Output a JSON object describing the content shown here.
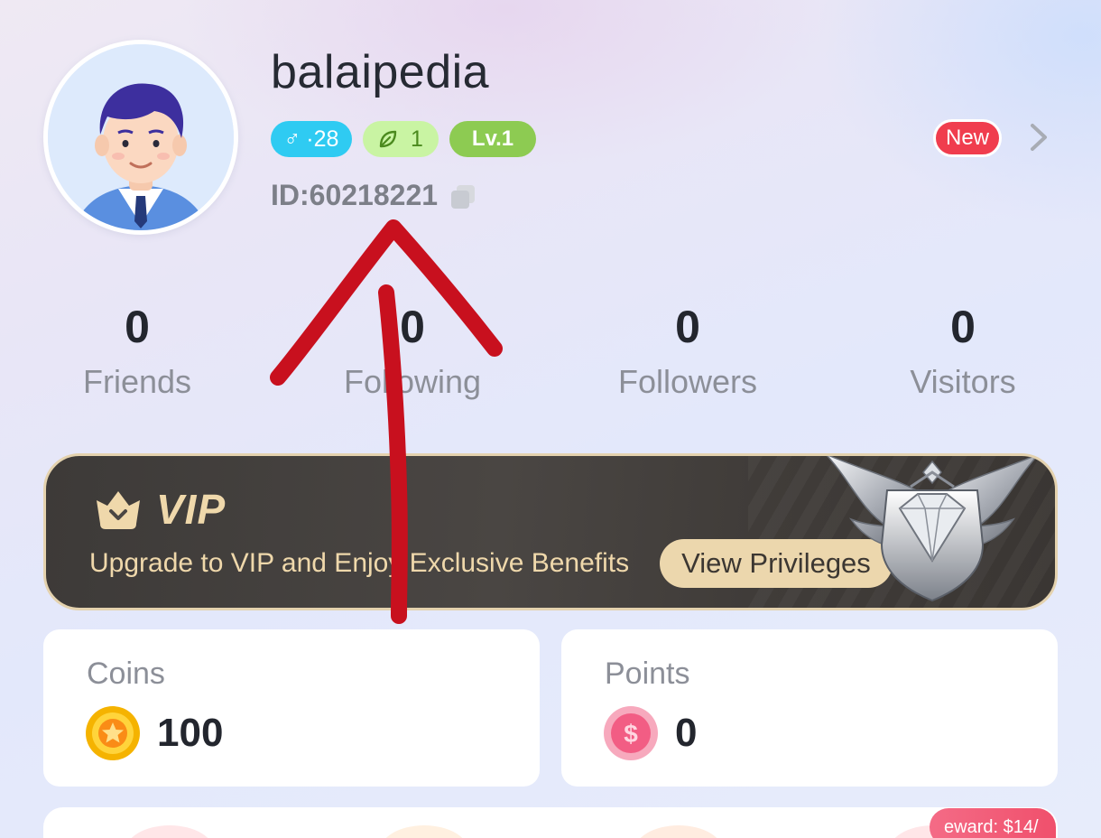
{
  "profile": {
    "username": "balaipedia",
    "gender_symbol": "♂",
    "age": "·28",
    "leaf_count": "1",
    "level": "Lv.1",
    "id": "ID:60218221",
    "new_badge": "New"
  },
  "stats": [
    {
      "value": "0",
      "label": "Friends"
    },
    {
      "value": "0",
      "label": "Following"
    },
    {
      "value": "0",
      "label": "Followers"
    },
    {
      "value": "0",
      "label": "Visitors"
    }
  ],
  "vip": {
    "title": "VIP",
    "description": "Upgrade to VIP and Enjoy Exclusive Benefits",
    "button": "View Privileges"
  },
  "wallet": {
    "coins": {
      "label": "Coins",
      "value": "100"
    },
    "points": {
      "label": "Points",
      "value": "0"
    }
  },
  "reward_tag": "eward: $14/",
  "colors": {
    "gender_badge": "#2fcbf2",
    "level_badge": "#8dcb52",
    "new_badge": "#f03d4e",
    "vip_gold": "#efd8ab",
    "annotation": "#c8101e"
  },
  "icons": [
    "copy-icon",
    "chevron-right-icon",
    "leaf-icon",
    "crown-icon",
    "coin-icon",
    "points-icon",
    "diamond-emblem-icon"
  ]
}
